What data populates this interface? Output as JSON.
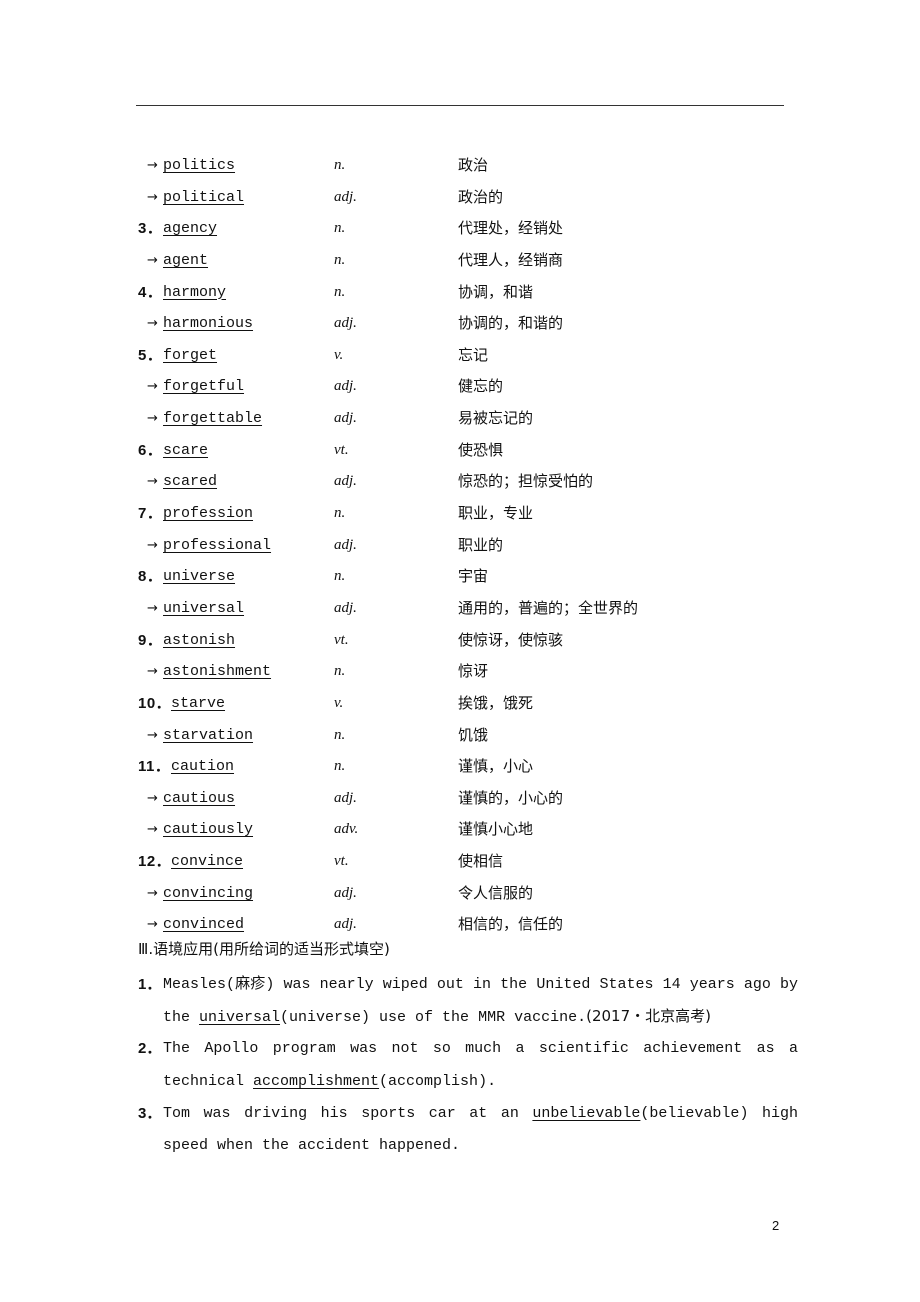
{
  "vocab": [
    {
      "lead": "→",
      "word": "politics",
      "pos": "n.",
      "gloss": "政治"
    },
    {
      "lead": "→",
      "word": "political",
      "pos": "adj.",
      "gloss": "政治的"
    },
    {
      "lead": "3．",
      "word": "agency",
      "pos": "n.",
      "gloss": "代理处，经销处"
    },
    {
      "lead": "→",
      "word": "agent",
      "pos": "n.",
      "gloss": "代理人，经销商"
    },
    {
      "lead": "4．",
      "word": "harmony",
      "pos": "n.",
      "gloss": "协调，和谐"
    },
    {
      "lead": "→",
      "word": "harmonious",
      "pos": "adj.",
      "gloss": "协调的，和谐的"
    },
    {
      "lead": "5．",
      "word": "forget",
      "pos": "v.",
      "gloss": "忘记"
    },
    {
      "lead": "→",
      "word": "forgetful",
      "pos": "adj.",
      "gloss": "健忘的"
    },
    {
      "lead": "→",
      "word": "forgettable",
      "pos": "adj.",
      "gloss": "易被忘记的"
    },
    {
      "lead": "6．",
      "word": "scare",
      "pos": "vt.",
      "gloss": "使恐惧"
    },
    {
      "lead": "→",
      "word": "scared",
      "pos": "adj.",
      "gloss": "惊恐的；担惊受怕的"
    },
    {
      "lead": "7．",
      "word": "profession",
      "pos": "n.",
      "gloss": "职业，专业"
    },
    {
      "lead": "→",
      "word": "professional",
      "pos": "adj.",
      "gloss": "职业的"
    },
    {
      "lead": "8．",
      "word": "universe",
      "pos": "n.",
      "gloss": "宇宙"
    },
    {
      "lead": "→",
      "word": "universal",
      "pos": "adj.",
      "gloss": "通用的，普遍的；全世界的"
    },
    {
      "lead": "9．",
      "word": "astonish",
      "pos": "vt.",
      "gloss": "使惊讶，使惊骇"
    },
    {
      "lead": "→",
      "word": "astonishment",
      "pos": "n.",
      "gloss": "惊讶"
    },
    {
      "lead": "10．",
      "word": "starve",
      "pos": "v.",
      "gloss": "挨饿，饿死"
    },
    {
      "lead": "→",
      "word": "starvation",
      "pos": "n.",
      "gloss": "饥饿"
    },
    {
      "lead": "11．",
      "word": "caution",
      "pos": "n.",
      "gloss": "谨慎，小心"
    },
    {
      "lead": "→",
      "word": "cautious",
      "pos": "adj.",
      "gloss": "谨慎的，小心的"
    },
    {
      "lead": "→",
      "word": "cautiously",
      "pos": "adv.",
      "gloss": "谨慎小心地"
    },
    {
      "lead": "12．",
      "word": "convince",
      "pos": "vt.",
      "gloss": "使相信"
    },
    {
      "lead": "→",
      "word": "convincing",
      "pos": "adj.",
      "gloss": "令人信服的"
    },
    {
      "lead": "→",
      "word": "convinced",
      "pos": "adj.",
      "gloss": "相信的，信任的"
    }
  ],
  "section": {
    "title": "Ⅲ.语境应用(用所给词的适当形式填空)"
  },
  "exercises": [
    {
      "num": "1．",
      "before": "Measles(麻疹) was nearly wiped out in the United States 14 years ago by the ",
      "answer": "universal",
      "after": "(universe) use of the MMR vaccine.",
      "source": "(2017・北京高考)"
    },
    {
      "num": "2．",
      "before": "The Apollo program was not so much a scientific achievement as a technical ",
      "answer": "accomplishment",
      "after": "(accomplish).",
      "source": ""
    },
    {
      "num": "3．",
      "before": "Tom was driving his sports car at an ",
      "answer": "unbelievable",
      "after": "(believable) high speed when the accident happened.",
      "source": ""
    }
  ],
  "footer": {
    "page_number": "2"
  }
}
